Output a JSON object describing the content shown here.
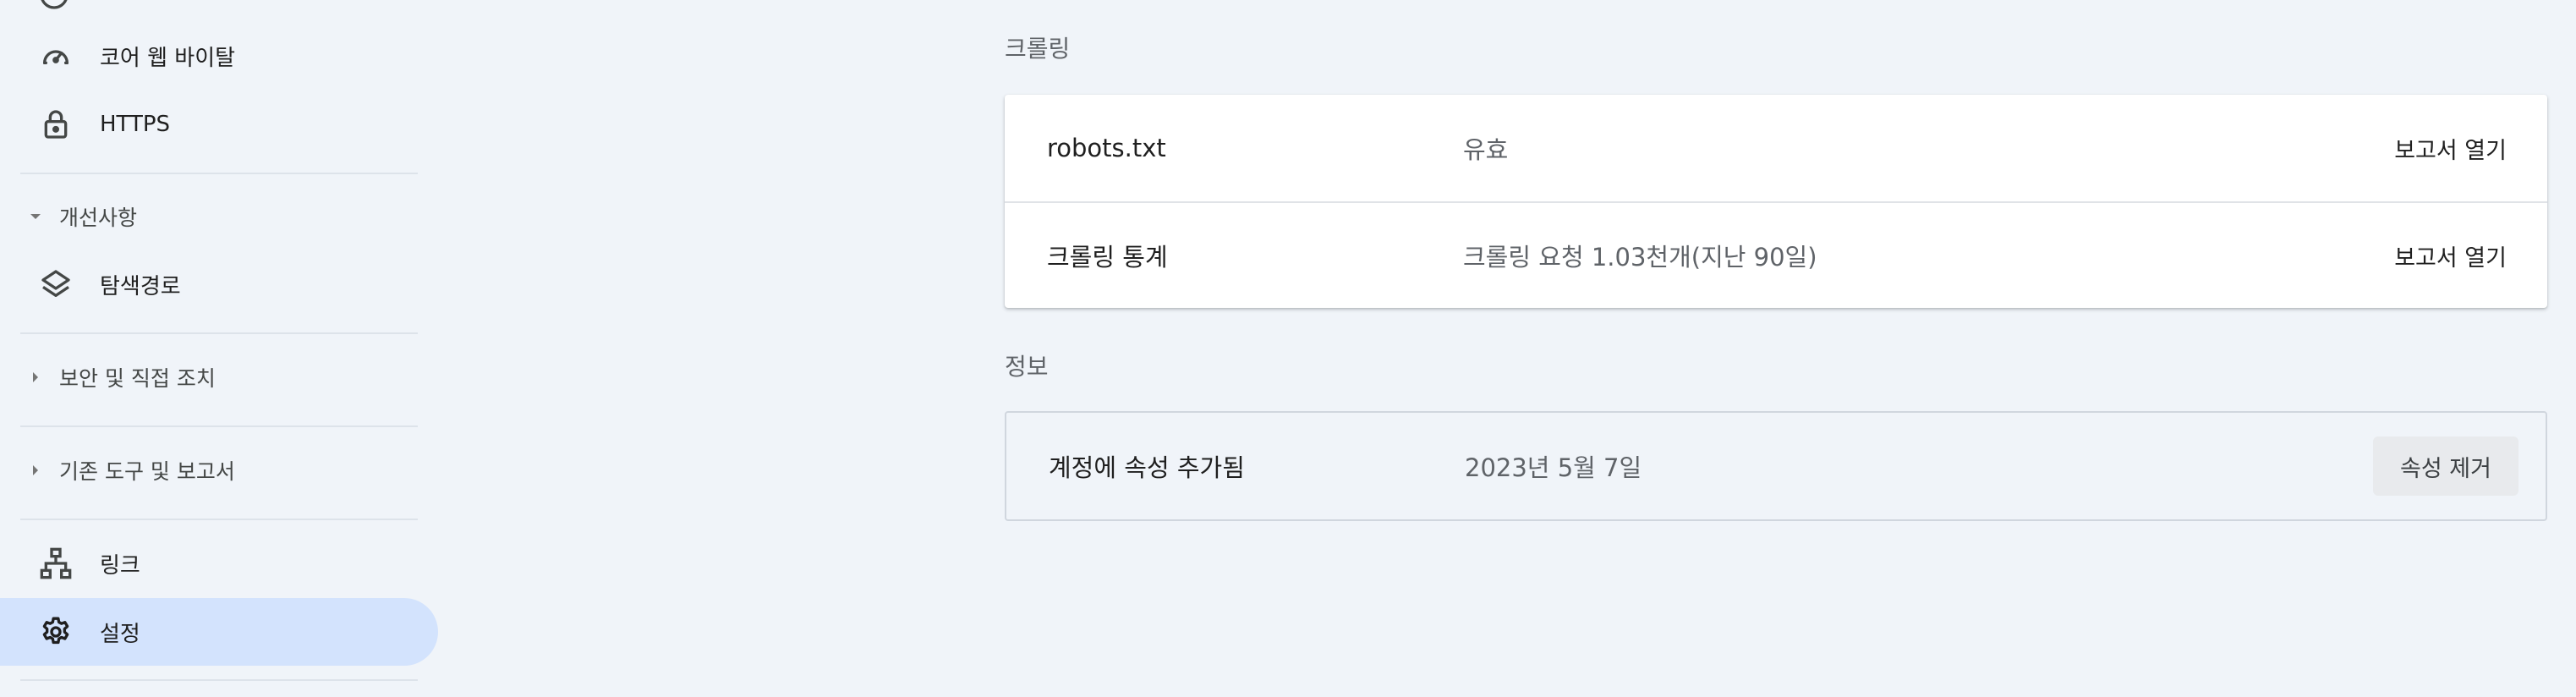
{
  "sidebar": {
    "items": [
      {
        "label": "코어 웹 바이탈",
        "icon": "speedometer-icon"
      },
      {
        "label": "HTTPS",
        "icon": "lock-icon"
      },
      {
        "label": "탐색경로",
        "icon": "layers-icon"
      },
      {
        "label": "링크",
        "icon": "sitemap-icon"
      },
      {
        "label": "설정",
        "icon": "gear-icon",
        "active": true
      }
    ],
    "sections": [
      {
        "label": "개선사항",
        "expanded": true
      },
      {
        "label": "보안 및 직접 조치",
        "expanded": false
      },
      {
        "label": "기존 도구 및 보고서",
        "expanded": false
      }
    ]
  },
  "main": {
    "crawling": {
      "title": "크롤링",
      "rows": [
        {
          "label": "robots.txt",
          "value": "유효",
          "action": "보고서 열기"
        },
        {
          "label": "크롤링 통계",
          "value": "크롤링 요청 1.03천개(지난 90일)",
          "action": "보고서 열기"
        }
      ]
    },
    "info": {
      "title": "정보",
      "rows": [
        {
          "label": "계정에 속성 추가됨",
          "value": "2023년 5월 7일",
          "button": "속성 제거"
        }
      ]
    }
  },
  "colors": {
    "background": "#f0f4f9",
    "active_nav": "#d3e3fd",
    "text_primary": "#1f1f1f",
    "text_secondary": "#5f6368"
  }
}
